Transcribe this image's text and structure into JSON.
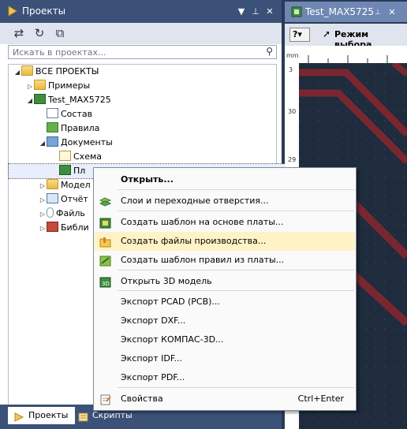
{
  "projects_panel": {
    "title": "Проекты",
    "search_placeholder": "Искать в проектах...",
    "tree": [
      {
        "label": "ВСЕ ПРОЕКТЫ",
        "level": 0,
        "expander": "◢",
        "icon": "folder-icon"
      },
      {
        "label": "Примеры",
        "level": 1,
        "expander": "▷",
        "icon": "folder-icon"
      },
      {
        "label": "Test_MAX5725",
        "level": 1,
        "expander": "◢",
        "icon": "board-icon"
      },
      {
        "label": "Состав",
        "level": 2,
        "expander": "",
        "icon": "list-icon"
      },
      {
        "label": "Правила",
        "level": 2,
        "expander": "",
        "icon": "rules-icon"
      },
      {
        "label": "Документы",
        "level": 2,
        "expander": "◢",
        "icon": "documents-icon"
      },
      {
        "label": "Схема",
        "level": 3,
        "expander": "",
        "icon": "schematic-icon"
      },
      {
        "label": "Пл",
        "level": 3,
        "expander": "",
        "icon": "board-icon"
      },
      {
        "label": "Модел",
        "level": 2,
        "expander": "▷",
        "icon": "folder-icon"
      },
      {
        "label": "Отчёт",
        "level": 2,
        "expander": "▷",
        "icon": "report-icon"
      },
      {
        "label": "Файль",
        "level": 2,
        "expander": "▷",
        "icon": "attachment-icon"
      },
      {
        "label": "Библи",
        "level": 2,
        "expander": "▷",
        "icon": "library-icon"
      }
    ]
  },
  "bottom_tabs": {
    "projects": "Проекты",
    "scripts": "Скрипты"
  },
  "editor": {
    "tab_title": "Test_MAX5725",
    "mode_label": "Режим выбора",
    "ruler_unit": "mm",
    "ruler_left_numbers": [
      "3",
      "30",
      "29"
    ]
  },
  "context_menu": [
    {
      "label": "Открыть...",
      "bold": true,
      "shortcut": "",
      "icon": ""
    },
    {
      "label": "Слои и переходные отверстия...",
      "shortcut": "",
      "icon": "layers-icon"
    },
    {
      "label": "Создать шаблон на основе платы...",
      "shortcut": "",
      "icon": "template-icon"
    },
    {
      "label": "Создать файлы производства...",
      "shortcut": "",
      "icon": "production-files-icon",
      "highlighted": true
    },
    {
      "label": "Создать шаблон правил из платы...",
      "shortcut": "",
      "icon": "rules-template-icon"
    },
    {
      "label": "Открыть 3D модель",
      "shortcut": "",
      "icon": "3d-model-icon"
    },
    {
      "label": "Экспорт PCAD (PCB)...",
      "shortcut": "",
      "icon": ""
    },
    {
      "label": "Экспорт DXF...",
      "shortcut": "",
      "icon": ""
    },
    {
      "label": "Экспорт КОМПАС-3D...",
      "shortcut": "",
      "icon": ""
    },
    {
      "label": "Экспорт IDF...",
      "shortcut": "",
      "icon": ""
    },
    {
      "label": "Экспорт PDF...",
      "shortcut": "",
      "icon": ""
    },
    {
      "label": "Свойства",
      "shortcut": "Ctrl+Enter",
      "icon": "properties-icon"
    }
  ]
}
